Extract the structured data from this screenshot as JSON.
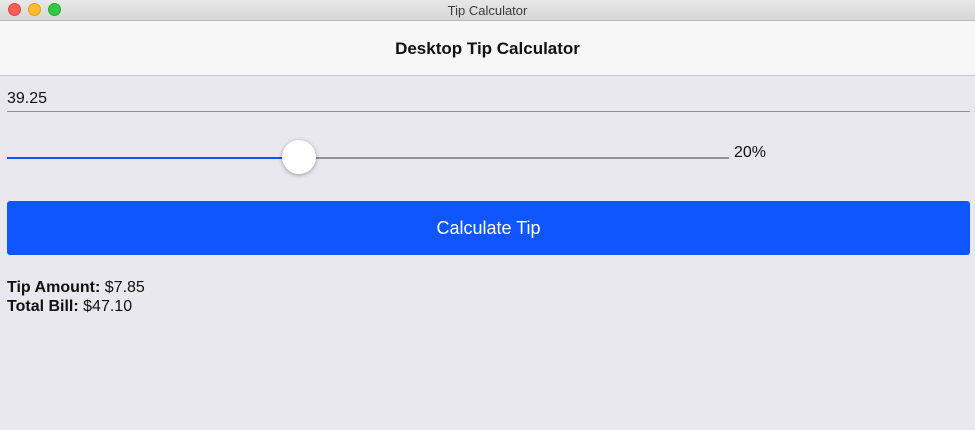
{
  "window": {
    "title": "Tip Calculator"
  },
  "header": {
    "title": "Desktop Tip Calculator"
  },
  "bill": {
    "value": "39.25"
  },
  "tip_slider": {
    "percent": 20,
    "value_label": "20%",
    "position_fraction": 0.404
  },
  "calculate_button": {
    "label": "Calculate Tip"
  },
  "results": {
    "tip_label": "Tip Amount:",
    "tip_value": "$7.85",
    "total_label": "Total Bill:",
    "total_value": "$47.10"
  },
  "colors": {
    "accent": "#0f56ff",
    "background": "#e9e8ef",
    "header_background": "#f7f7f7",
    "track_inactive": "#8e8e93"
  },
  "icons": {
    "close": "close-icon",
    "minimize": "minimize-icon",
    "maximize": "maximize-icon"
  }
}
